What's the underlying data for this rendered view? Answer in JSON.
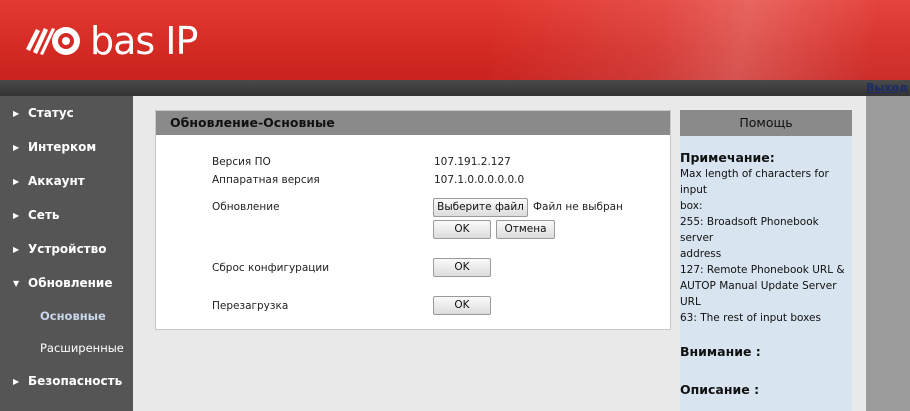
{
  "header": {
    "brand": "bas IP",
    "logout": "Выход"
  },
  "sidebar": {
    "items": [
      {
        "label": "Статус",
        "arrow": "▶"
      },
      {
        "label": "Интерком",
        "arrow": "▶"
      },
      {
        "label": "Аккаунт",
        "arrow": "▶"
      },
      {
        "label": "Сеть",
        "arrow": "▶"
      },
      {
        "label": "Устройство",
        "arrow": "▶"
      },
      {
        "label": "Обновление",
        "arrow": "▼"
      },
      {
        "label": "Безопасность",
        "arrow": "▶"
      }
    ],
    "subitems": [
      {
        "label": "Основные",
        "active": true
      },
      {
        "label": "Расширенные",
        "active": false
      }
    ]
  },
  "panel": {
    "title": "Обновление-Основные",
    "firmware_label": "Версия ПО",
    "firmware_value": "107.191.2.127",
    "hardware_label": "Аппаратная версия",
    "hardware_value": "107.1.0.0.0.0.0.0",
    "update_label": "Обновление",
    "choose_file": "Выберите файл",
    "file_status": "Файл не выбран",
    "ok": "OK",
    "cancel": "Отмена",
    "reset_label": "Сброс конфигурации",
    "reboot_label": "Перезагрузка"
  },
  "help": {
    "title": "Помощь",
    "note_heading": "Примечание:",
    "note_lines": [
      "Max length of characters for input",
      "box:",
      "255: Broadsoft Phonebook server",
      "address",
      "127: Remote Phonebook URL &",
      "AUTOP Manual Update Server URL",
      "63: The rest of input boxes"
    ],
    "warning_heading": "Внимание :",
    "description_heading": "Описание :"
  }
}
